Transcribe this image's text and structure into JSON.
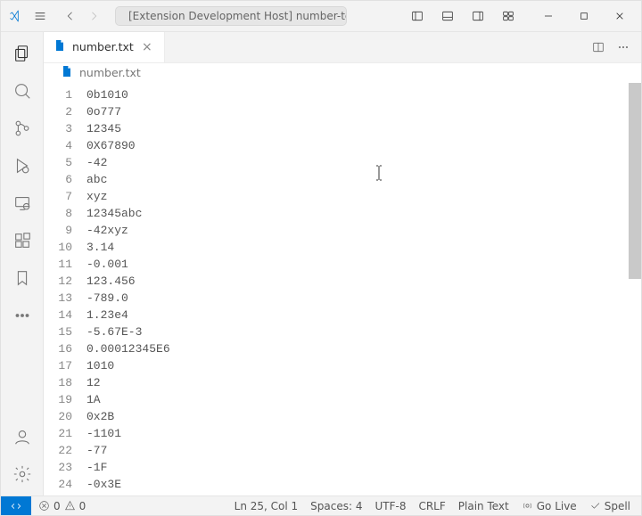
{
  "title": "[Extension Development Host] number-test",
  "tab": {
    "filename": "number.txt"
  },
  "breadcrumb": {
    "filename": "number.txt"
  },
  "lines": [
    "0b1010",
    "0o777",
    "12345",
    "0X67890",
    "-42",
    "abc",
    "xyz",
    "12345abc",
    "-42xyz",
    "3.14",
    "-0.001",
    "123.456",
    "-789.0",
    "1.23e4",
    "-5.67E-3",
    "0.00012345E6",
    "1010",
    "12",
    "1A",
    "0x2B",
    "-1101",
    "-77",
    "-1F",
    "-0x3E"
  ],
  "status": {
    "errors": "0",
    "warnings": "0",
    "cursor": "Ln 25, Col 1",
    "spaces": "Spaces: 4",
    "encoding": "UTF-8",
    "eol": "CRLF",
    "lang": "Plain Text",
    "golive": "Go Live",
    "spell": "Spell"
  }
}
